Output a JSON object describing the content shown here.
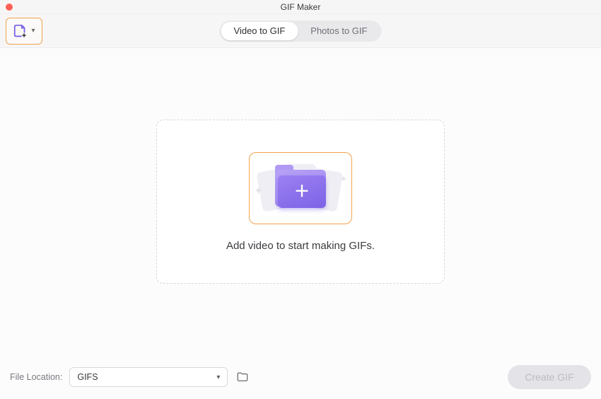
{
  "window": {
    "title": "GIF Maker"
  },
  "toolbar": {
    "add_icon_name": "new-file-icon"
  },
  "tabs": {
    "items": [
      {
        "label": "Video to GIF",
        "active": true
      },
      {
        "label": "Photos to GIF",
        "active": false
      }
    ]
  },
  "dropzone": {
    "prompt": "Add video to start making GIFs."
  },
  "footer": {
    "location_label": "File Location:",
    "location_value": "GIFS",
    "create_label": "Create GIF"
  },
  "colors": {
    "accent_orange": "#f3a24c",
    "accent_purple": "#8a6df0"
  }
}
